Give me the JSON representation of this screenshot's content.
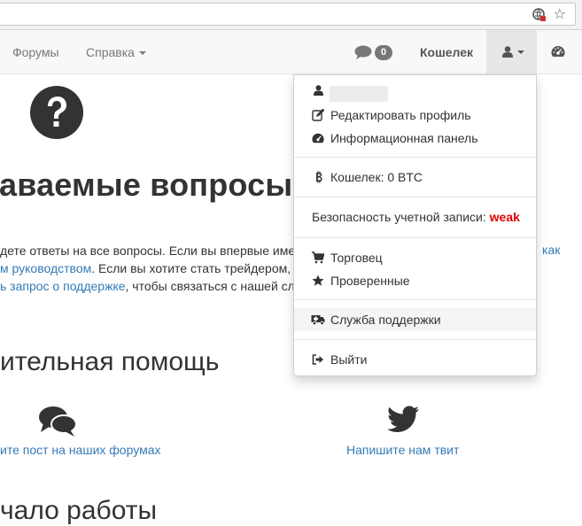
{
  "navbar": {
    "forums": "Форумы",
    "help": "Справка",
    "messages_count": "0",
    "wallet": "Кошелек"
  },
  "content": {
    "heading": "аваемые вопросы",
    "p1_text": "дете ответы на все вопросы. Если вы впервые име",
    "p1_link_right": "как",
    "p2_link": "м руководством",
    "p2_text": ". Если вы хотите стать трейдером, ,",
    "p3_link": "ь запрос о поддержке",
    "p3_text": ", чтобы связаться с нашей слу",
    "help_heading": "ительная помощь",
    "forum_link": "ите пост на наших форумах",
    "twitter_link": "Напишите нам твит",
    "next_heading": "чало работы"
  },
  "dropdown": {
    "edit_profile": "Редактировать профиль",
    "dashboard": "Информационная панель",
    "wallet": "Кошелек: 0 BTC",
    "security_label": "Безопасность учетной записи:",
    "security_value": "weak",
    "merchant": "Торговец",
    "verified": "Проверенные",
    "support": "Служба поддержки",
    "logout": "Выйти"
  },
  "colors": {
    "link": "#337ab7",
    "weak": "#e10000",
    "navbar_bg": "#f8f8f8",
    "active_nav_bg": "#e7e7e7"
  },
  "icons": [
    "user-icon",
    "edit-icon",
    "dashboard-icon",
    "bitcoin-icon",
    "cart-icon",
    "star-icon",
    "ambulance-icon",
    "sign-out-icon",
    "comments-icon",
    "question-circle-icon",
    "twitter-icon",
    "bookmark-star-icon"
  ]
}
